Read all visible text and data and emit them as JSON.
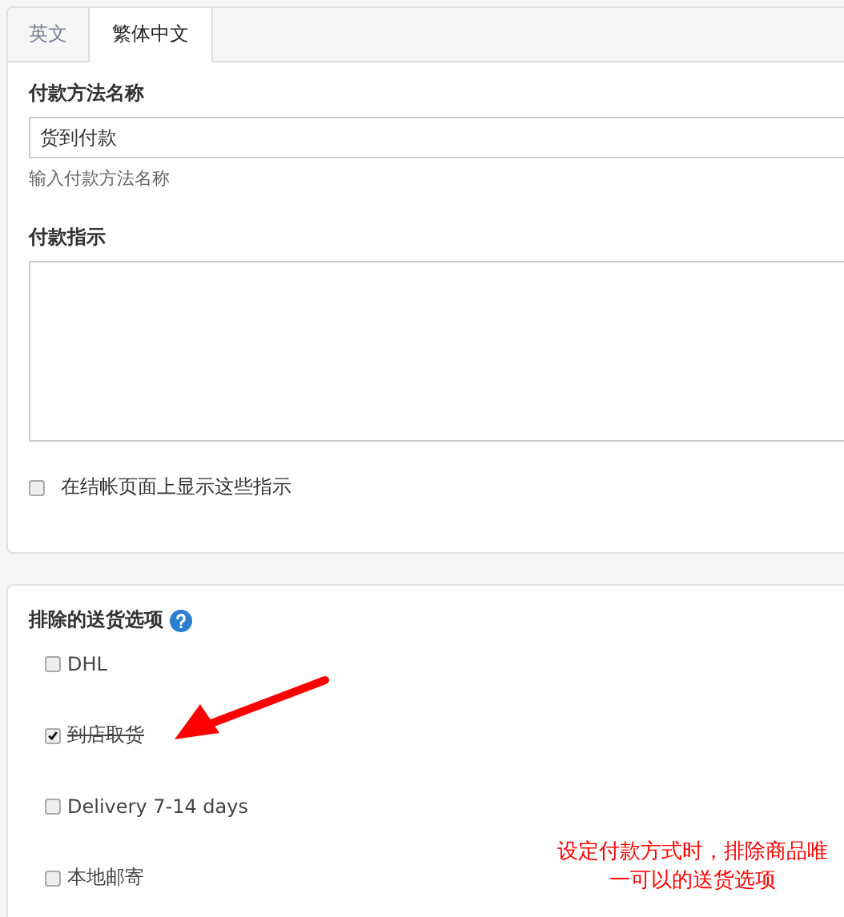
{
  "tabs": [
    {
      "label": "英文",
      "selected": false
    },
    {
      "label": "繁体中文",
      "selected": true
    }
  ],
  "name_field": {
    "label": "付款方法名称",
    "value": "货到付款",
    "help": "输入付款方法名称"
  },
  "instructions": {
    "label": "付款指示"
  },
  "show_at_checkout": {
    "label": "在结帐页面上显示这些指示",
    "checked": false
  },
  "excluded_shipping": {
    "label": "排除的送货选项",
    "options": [
      {
        "label": "DHL",
        "checked": false
      },
      {
        "label": "到店取货",
        "checked": true
      },
      {
        "label": "Delivery 7-14 days",
        "checked": false
      },
      {
        "label": "本地邮寄",
        "checked": false
      }
    ]
  },
  "annotation": {
    "text": "设定付款方式时，排除商品唯一可以的送货选项"
  }
}
